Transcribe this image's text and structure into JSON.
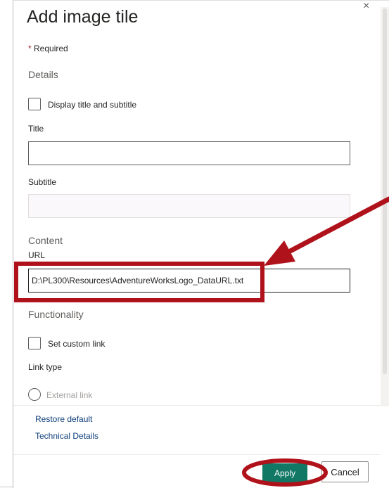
{
  "dialog": {
    "title": "Add image tile",
    "close_glyph": "×",
    "required_star": "*",
    "required_text": "Required"
  },
  "details": {
    "heading": "Details",
    "display_title_label": "Display title and subtitle",
    "title_label": "Title",
    "title_value": "",
    "subtitle_label": "Subtitle",
    "subtitle_value": ""
  },
  "content": {
    "heading": "Content",
    "url_label": "URL",
    "url_value": "D:\\PL300\\Resources\\AdventureWorksLogo_DataURL.txt"
  },
  "functionality": {
    "heading": "Functionality",
    "custom_link_label": "Set custom link",
    "link_type_label": "Link type",
    "external_link_label": "External link"
  },
  "links": {
    "restore_default": "Restore default",
    "technical_details": "Technical Details"
  },
  "footer": {
    "apply_label": "Apply",
    "cancel_label": "Cancel"
  },
  "colors": {
    "accent": "#117865",
    "annotation": "#b0121b",
    "required": "#a4262c",
    "link": "#0f3f7a"
  },
  "icons": [
    "close-icon",
    "arrow-annotation-icon"
  ]
}
